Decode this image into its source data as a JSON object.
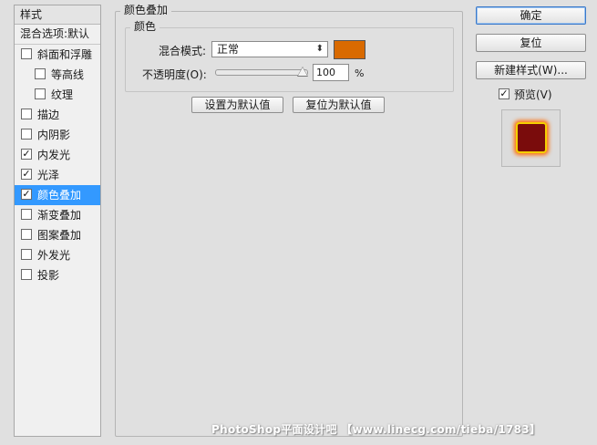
{
  "styles_panel": {
    "header": "样式",
    "blending_options": "混合选项:默认",
    "items": [
      {
        "label": "斜面和浮雕",
        "checked": false,
        "indent": 0,
        "selected": false
      },
      {
        "label": "等高线",
        "checked": false,
        "indent": 1,
        "selected": false
      },
      {
        "label": "纹理",
        "checked": false,
        "indent": 1,
        "selected": false
      },
      {
        "label": "描边",
        "checked": false,
        "indent": 0,
        "selected": false
      },
      {
        "label": "内阴影",
        "checked": false,
        "indent": 0,
        "selected": false
      },
      {
        "label": "内发光",
        "checked": true,
        "indent": 0,
        "selected": false
      },
      {
        "label": "光泽",
        "checked": true,
        "indent": 0,
        "selected": false
      },
      {
        "label": "颜色叠加",
        "checked": true,
        "indent": 0,
        "selected": true
      },
      {
        "label": "渐变叠加",
        "checked": false,
        "indent": 0,
        "selected": false
      },
      {
        "label": "图案叠加",
        "checked": false,
        "indent": 0,
        "selected": false
      },
      {
        "label": "外发光",
        "checked": false,
        "indent": 0,
        "selected": false
      },
      {
        "label": "投影",
        "checked": false,
        "indent": 0,
        "selected": false
      }
    ]
  },
  "color_overlay": {
    "title": "颜色叠加",
    "color_group_title": "颜色",
    "blend_mode_label": "混合模式:",
    "blend_mode_value": "正常",
    "overlay_color": "#d96a00",
    "opacity_label": "不透明度(O):",
    "opacity_value": "100",
    "opacity_unit": "%",
    "set_default_label": "设置为默认值",
    "reset_default_label": "复位为默认值"
  },
  "actions": {
    "ok_label": "确定",
    "reset_label": "复位",
    "new_style_label": "新建样式(W)...",
    "preview_label": "预览(V)",
    "preview_checked": true
  },
  "watermark": "PhotoShop平面设计吧 【www.linecg.com/tieba/1783】"
}
